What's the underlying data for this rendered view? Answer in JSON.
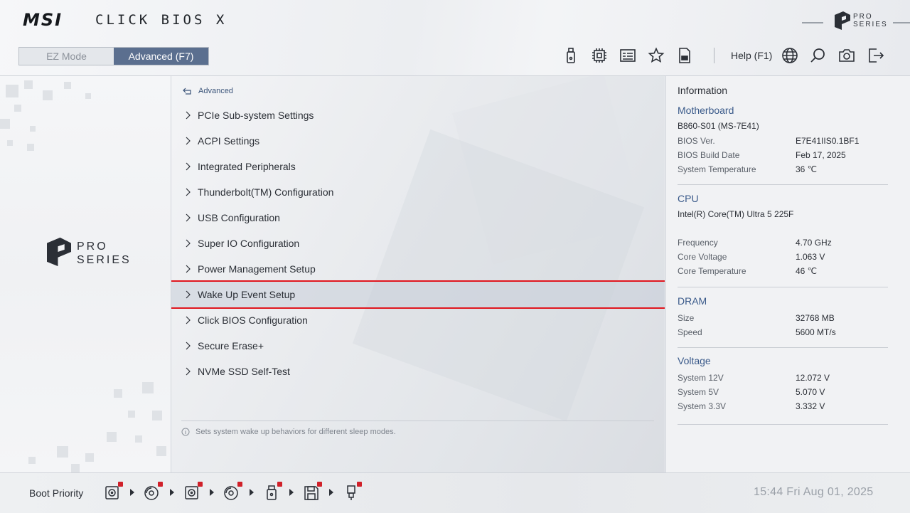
{
  "header": {
    "brand": "MSI",
    "product": "CLICK BIOS X",
    "pro_series": [
      "PRO",
      "SERIES"
    ],
    "modes": {
      "ez": "EZ Mode",
      "advanced": "Advanced (F7)",
      "active": "advanced"
    },
    "toolbar": {
      "icons": [
        "usb-flash-icon",
        "cpu-chip-icon",
        "hardware-monitor-icon",
        "favorites-star-icon",
        "bios-file-icon"
      ],
      "help_label": "Help (F1)",
      "right_icons": [
        "language-globe-icon",
        "search-icon",
        "screenshot-camera-icon",
        "exit-icon"
      ]
    }
  },
  "main": {
    "breadcrumb": "Advanced",
    "menu": [
      {
        "label": "PCIe Sub-system Settings"
      },
      {
        "label": "ACPI Settings"
      },
      {
        "label": "Integrated Peripherals"
      },
      {
        "label": "Thunderbolt(TM) Configuration"
      },
      {
        "label": "USB Configuration"
      },
      {
        "label": "Super IO Configuration"
      },
      {
        "label": "Power Management Setup"
      },
      {
        "label": "Wake Up Event Setup"
      },
      {
        "label": "Click BIOS Configuration"
      },
      {
        "label": "Secure Erase+"
      },
      {
        "label": "NVMe SSD Self-Test"
      }
    ],
    "selected": "Wake Up Event Setup",
    "help_text": "Sets system wake up behaviors for different sleep modes."
  },
  "info": {
    "title": "Information",
    "motherboard": {
      "heading": "Motherboard",
      "model": "B860-S01 (MS-7E41)",
      "rows": [
        {
          "label": "BIOS Ver.",
          "value": "E7E41IIS0.1BF1"
        },
        {
          "label": "BIOS Build Date",
          "value": "Feb 17, 2025"
        },
        {
          "label": "System Temperature",
          "value": "36 ℃"
        }
      ]
    },
    "cpu": {
      "heading": "CPU",
      "model": "Intel(R) Core(TM) Ultra 5 225F",
      "rows": [
        {
          "label": "Frequency",
          "value": "4.70 GHz"
        },
        {
          "label": "Core Voltage",
          "value": "1.063 V"
        },
        {
          "label": "Core Temperature",
          "value": "46 ℃"
        }
      ]
    },
    "dram": {
      "heading": "DRAM",
      "rows": [
        {
          "label": "Size",
          "value": "32768 MB"
        },
        {
          "label": "Speed",
          "value": "5600 MT/s"
        }
      ]
    },
    "voltage": {
      "heading": "Voltage",
      "rows": [
        {
          "label": "System 12V",
          "value": "12.072 V"
        },
        {
          "label": "System 5V",
          "value": "5.070 V"
        },
        {
          "label": "System 3.3V",
          "value": "3.332 V"
        }
      ]
    }
  },
  "bottom": {
    "boot_label": "Boot Priority",
    "boot_devices": [
      "hdd-icon",
      "optical-disc-icon",
      "hdd-icon",
      "optical-disc-icon",
      "usb-drive-icon",
      "floppy-icon",
      "usb-stick-icon"
    ],
    "clock": "15:44  Fri Aug 01, 2025"
  },
  "colors": {
    "accent": "#5b6f8f",
    "highlight_border": "#e0161e",
    "heading_blue": "#3a5a8a"
  }
}
